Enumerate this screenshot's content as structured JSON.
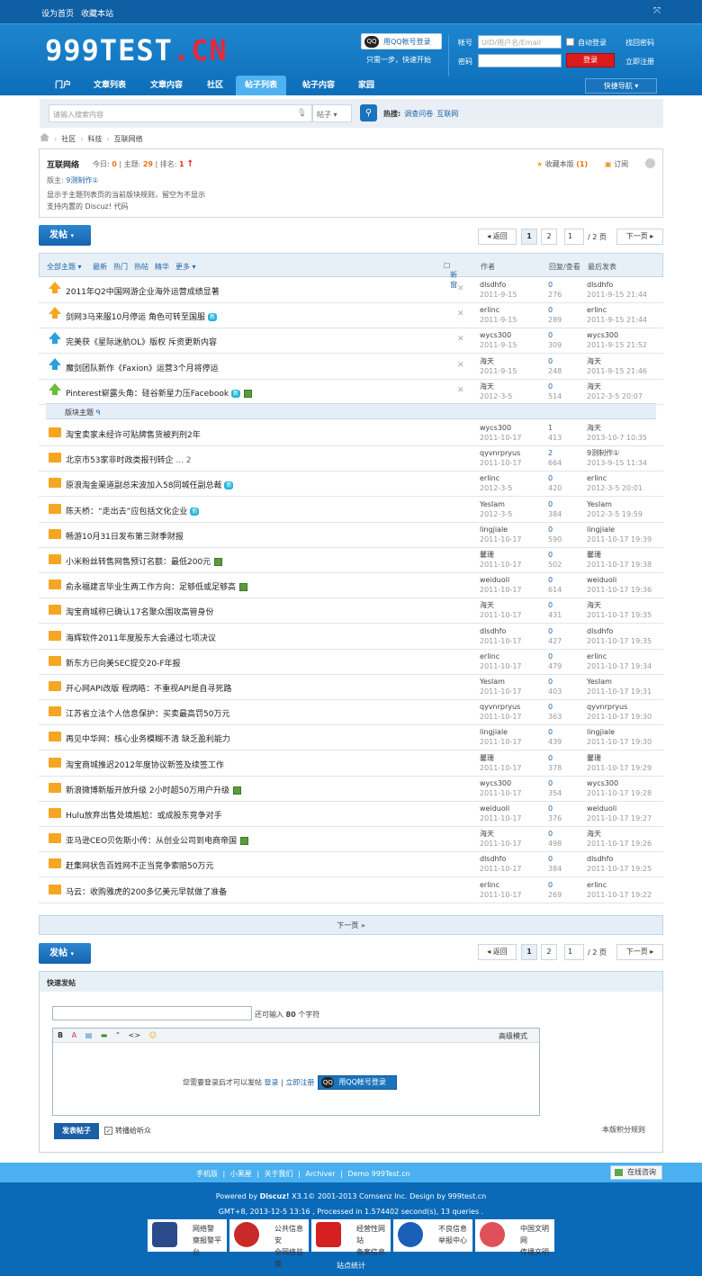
{
  "topbar": {
    "set_home": "设为首页",
    "bookmark": "收藏本站"
  },
  "logo": {
    "main": "999TEST",
    "suffix": ".CN"
  },
  "login": {
    "qq_btn": "用QQ帐号登录",
    "qq_sub": "只需一步，快速开始",
    "account_label": "帐号",
    "account_placeholder": "UID/用户名/Email",
    "auto_login": "自动登录",
    "find_pwd": "找回密码",
    "pwd_label": "密码",
    "login_btn": "登录",
    "register": "立即注册"
  },
  "nav": {
    "items": [
      "门户",
      "文章列表",
      "文章内容",
      "社区",
      "帖子列表",
      "帖子内容",
      "家园"
    ],
    "active": "帖子列表",
    "quick_nav": "快捷导航 ▾"
  },
  "search": {
    "placeholder": "请输入搜索内容",
    "type": "帖子 ▾",
    "hot_label": "热搜:",
    "hot": [
      "调查问卷",
      "互联网"
    ]
  },
  "breadcrumb": [
    "社区",
    "科技",
    "互联网络"
  ],
  "forum": {
    "name": "互联网络",
    "today_label": "今日:",
    "today": "0",
    "topics_label": "主题:",
    "topics": "29",
    "rank_label": "排名:",
    "rank": "1",
    "moderator_label": "版主:",
    "moderator": "9测制作①",
    "desc1": "显示于主题列表页的当前版块规则，留空为不显示",
    "desc2": "支持内置的 Discuz! 代码",
    "fav": "收藏本版",
    "fav_count": "(1)",
    "rss": "订阅"
  },
  "post_btn": "发帖",
  "pager": {
    "back": "◂ 返回",
    "p1": "1",
    "p2": "2",
    "input": "1",
    "total": "/ 2 页",
    "next": "下一页 ▸"
  },
  "filters": {
    "all": "全部主题 ▾",
    "latest": "最新",
    "hot": "热门",
    "hotpost": "热帖",
    "digest": "精华",
    "more": "更多 ▾",
    "new_chk": "新窗",
    "author": "作者",
    "replies": "回复/查看",
    "last": "最后发表"
  },
  "sticky": [
    {
      "title": "2011年Q2中国网游企业海外运营成绩显著",
      "author": "dlsdhfo",
      "date": "2011-9-15",
      "r": "0",
      "v": "276",
      "lu": "dlsdhfo",
      "lt": "2011-9-15 21:44",
      "icon": "orange",
      "tag": ""
    },
    {
      "title": "剑网3马来服10月停运 角色可转至国服",
      "author": "erlinc",
      "date": "2011-9-15",
      "r": "0",
      "v": "289",
      "lu": "erlinc",
      "lt": "2011-9-15 21:44",
      "icon": "orange",
      "tag": "新"
    },
    {
      "title": "完美获《星际迷航OL》版权 斥资更新内容",
      "author": "wycs300",
      "date": "2011-9-15",
      "r": "0",
      "v": "309",
      "lu": "wycs300",
      "lt": "2011-9-15 21:52",
      "icon": "blue",
      "tag": ""
    },
    {
      "title": "魔剑团队新作《Faxion》运营3个月将停运",
      "author": "海天",
      "date": "2011-9-15",
      "r": "0",
      "v": "248",
      "lu": "海天",
      "lt": "2011-9-15 21:46",
      "icon": "blue",
      "tag": ""
    },
    {
      "title": "Pinterest崭露头角：硅谷新星力压Facebook",
      "author": "海天",
      "date": "2012-3-5",
      "r": "0",
      "v": "514",
      "lu": "海天",
      "lt": "2012-3-5 20:07",
      "icon": "green",
      "tag": "新",
      "pic": true
    }
  ],
  "section_label": "版块主题",
  "normal": [
    {
      "title": "淘宝卖家未经许可贴牌售货被判刑2年",
      "author": "wycs300",
      "date": "2011-10-17",
      "r": "1",
      "v": "413",
      "lu": "海天",
      "lt": "2013-10-7 10:35"
    },
    {
      "title": "北京市53家非时政类报刊转企",
      "pg": " ... 2",
      "author": "qyvnrpryus",
      "date": "2011-10-17",
      "r": "2",
      "v": "664",
      "lu": "9测制作①",
      "lt": "2013-9-15 11:34"
    },
    {
      "title": "原浪淘金渠道副总宋波加入58同城任副总裁",
      "tag": "新",
      "author": "erlinc",
      "date": "2012-3-5",
      "r": "0",
      "v": "420",
      "lu": "erlinc",
      "lt": "2012-3-5 20:01"
    },
    {
      "title": "陈天桥：“走出去”应包括文化企业",
      "tag": "新",
      "author": "YesIam",
      "date": "2012-3-5",
      "r": "0",
      "v": "384",
      "lu": "YesIam",
      "lt": "2012-3-5 19:59"
    },
    {
      "title": "畅游10月31日发布第三财季财报",
      "author": "lingjiale",
      "date": "2011-10-17",
      "r": "0",
      "v": "590",
      "lu": "lingjiale",
      "lt": "2011-10-17 19:39"
    },
    {
      "title": "小米粉丝转售网售预订名额：最低200元",
      "pic": true,
      "author": "馨珊",
      "date": "2011-10-17",
      "r": "0",
      "v": "502",
      "lu": "馨珊",
      "lt": "2011-10-17 19:38"
    },
    {
      "title": "俞永福建言毕业生两工作方向：足够低或足够高",
      "pic": true,
      "author": "weiduoli",
      "date": "2011-10-17",
      "r": "0",
      "v": "614",
      "lu": "weiduoli",
      "lt": "2011-10-17 19:36"
    },
    {
      "title": "淘宝商城称已确认17名聚众围攻高管身份",
      "author": "海天",
      "date": "2011-10-17",
      "r": "0",
      "v": "431",
      "lu": "海天",
      "lt": "2011-10-17 19:35"
    },
    {
      "title": "海辉软件2011年度股东大会通过七项决议",
      "author": "dlsdhfo",
      "date": "2011-10-17",
      "r": "0",
      "v": "427",
      "lu": "dlsdhfo",
      "lt": "2011-10-17 19:35"
    },
    {
      "title": "新东方已向美SEC提交20-F年报",
      "author": "erlinc",
      "date": "2011-10-17",
      "r": "0",
      "v": "479",
      "lu": "erlinc",
      "lt": "2011-10-17 19:34"
    },
    {
      "title": "开心网API改版 程炳皓：不重视API是自寻死路",
      "author": "YesIam",
      "date": "2011-10-17",
      "r": "0",
      "v": "403",
      "lu": "YesIam",
      "lt": "2011-10-17 19:31"
    },
    {
      "title": "江苏省立法个人信息保护：买卖最高罚50万元",
      "author": "qyvnrpryus",
      "date": "2011-10-17",
      "r": "0",
      "v": "363",
      "lu": "qyvnrpryus",
      "lt": "2011-10-17 19:30"
    },
    {
      "title": "再见中华网：核心业务模糊不清 缺乏盈利能力",
      "author": "lingjiale",
      "date": "2011-10-17",
      "r": "0",
      "v": "439",
      "lu": "lingjiale",
      "lt": "2011-10-17 19:30"
    },
    {
      "title": "淘宝商城推迟2012年度协议新签及续签工作",
      "author": "馨珊",
      "date": "2011-10-17",
      "r": "0",
      "v": "378",
      "lu": "馨珊",
      "lt": "2011-10-17 19:29"
    },
    {
      "title": "新浪微博新版开放升级 2小时超50万用户升级",
      "pic": true,
      "author": "wycs300",
      "date": "2011-10-17",
      "r": "0",
      "v": "354",
      "lu": "wycs300",
      "lt": "2011-10-17 19:28"
    },
    {
      "title": "Hulu放弃出售处境尴尬：或成股东竞争对手",
      "author": "weiduoli",
      "date": "2011-10-17",
      "r": "0",
      "v": "376",
      "lu": "weiduoli",
      "lt": "2011-10-17 19:27"
    },
    {
      "title": "亚马逊CEO贝佐斯小传：从创业公司到电商帝国",
      "pic": true,
      "author": "海天",
      "date": "2011-10-17",
      "r": "0",
      "v": "498",
      "lu": "海天",
      "lt": "2011-10-17 19:26"
    },
    {
      "title": "赶集网状告百姓网不正当竞争索赔50万元",
      "author": "dlsdhfo",
      "date": "2011-10-17",
      "r": "0",
      "v": "384",
      "lu": "dlsdhfo",
      "lt": "2011-10-17 19:25"
    },
    {
      "title": "马云：收购雅虎的200多亿美元早就做了准备",
      "author": "erlinc",
      "date": "2011-10-17",
      "r": "0",
      "v": "269",
      "lu": "erlinc",
      "lt": "2011-10-17 19:22"
    }
  ],
  "next_page": "下一页 »",
  "quickpost": {
    "title": "快速发帖",
    "remain": "还可输入",
    "count": "80",
    "chars": "个字符",
    "tools": [
      "B",
      "A",
      "▤",
      "▬",
      "“",
      "<>",
      "☺"
    ],
    "adv": "高级模式",
    "need_login": "您需要登录后才可以发帖",
    "login": "登录",
    "register": "立即注册",
    "qq": "用QQ帐号登录",
    "submit": "发表帖子",
    "sync": "转播给听众",
    "rules": "本版积分规则"
  },
  "footer": {
    "links": [
      "手机版",
      "小黑屋",
      "关于我们",
      "Archiver",
      "Demo 999Test.cn"
    ],
    "online": "在线咨询",
    "powered": "Powered by ",
    "discuz": "Discuz!",
    "powered2": " X3.1© 2001-2013 Comsenz Inc. Design by 999test.cn",
    "gmt": "GMT+8, 2013-12-5 13:16 , Processed in 1.574402 second(s), 13 queries .",
    "badges": [
      [
        "网络警",
        "察报警平台"
      ],
      [
        "公共信息安",
        "全网络监察"
      ],
      [
        "经营性网站",
        "备案信息"
      ],
      [
        "不良信息",
        "举报中心"
      ],
      [
        "中国文明网",
        "传播文明"
      ]
    ],
    "stats": "站点统计"
  },
  "colors": {
    "brand_blue": "#0e5fa4",
    "accent_orange": "#f26c0c",
    "login_red": "#d91b1b"
  }
}
